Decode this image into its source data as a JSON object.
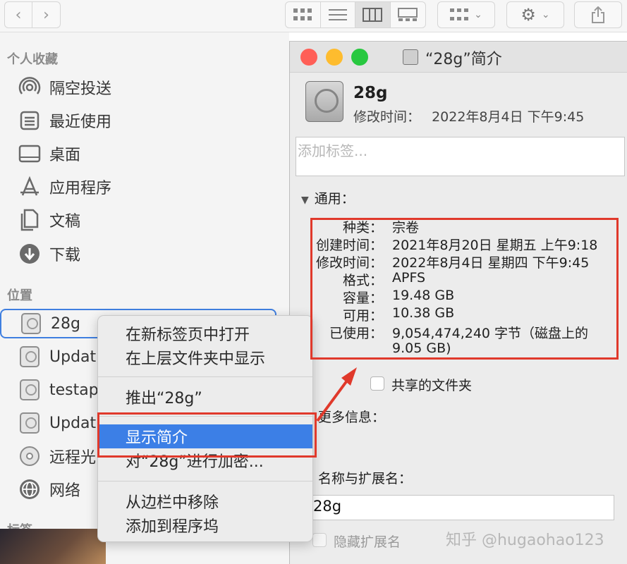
{
  "sidebar": {
    "favorites_title": "个人收藏",
    "favorites": [
      {
        "label": "隔空投送",
        "icon": "airdrop-icon"
      },
      {
        "label": "最近使用",
        "icon": "recents-icon"
      },
      {
        "label": "桌面",
        "icon": "desktop-icon"
      },
      {
        "label": "应用程序",
        "icon": "applications-icon"
      },
      {
        "label": "文稿",
        "icon": "documents-icon"
      },
      {
        "label": "下载",
        "icon": "downloads-icon"
      }
    ],
    "locations_title": "位置",
    "locations": [
      {
        "label": "28g",
        "icon": "drive-icon"
      },
      {
        "label": "Updat",
        "icon": "drive-icon"
      },
      {
        "label": "testap",
        "icon": "drive-icon"
      },
      {
        "label": "Updat",
        "icon": "drive-icon"
      },
      {
        "label": "远程光",
        "icon": "optical-disc-icon"
      },
      {
        "label": "网络",
        "icon": "network-icon"
      }
    ],
    "tags_title": "标签"
  },
  "context_menu": {
    "items": [
      "在新标签页中打开",
      "在上层文件夹中显示",
      "推出“28g”",
      "显示简介",
      "对“28g”进行加密...",
      "从边栏中移除",
      "添加到程序坞"
    ],
    "highlighted": "显示简介"
  },
  "info_window": {
    "title": "“28g”简介",
    "name": "28g",
    "modified_label": "修改时间：",
    "modified_value": "2022年8月4日 下午9:45",
    "tags_placeholder": "添加标签...",
    "general_header": "通用：",
    "details": [
      {
        "label": "种类：",
        "value": "宗卷"
      },
      {
        "label": "创建时间：",
        "value": "2021年8月20日 星期五 上午9:18"
      },
      {
        "label": "修改时间：",
        "value": "2022年8月4日 星期四 下午9:45"
      },
      {
        "label": "格式：",
        "value": "APFS"
      },
      {
        "label": "容量：",
        "value": "19.48 GB"
      },
      {
        "label": "可用：",
        "value": "10.38 GB"
      },
      {
        "label": "已使用：",
        "value": "9,054,474,240 字节（磁盘上的"
      }
    ],
    "used_value_cont": "9.05 GB)",
    "shared_folder_label": "共享的文件夹",
    "more_info_header": "更多信息：",
    "name_ext_header": "名称与扩展名：",
    "name_field_value": "28g",
    "hide_ext_label": "隐藏扩展名"
  },
  "watermark": "知乎 @hugaohao123",
  "colors": {
    "selection_blue": "#3c7fe6",
    "annotation_red": "#e0392b",
    "close": "#ff5f57",
    "minimize": "#febc2e",
    "zoom": "#28c840"
  }
}
